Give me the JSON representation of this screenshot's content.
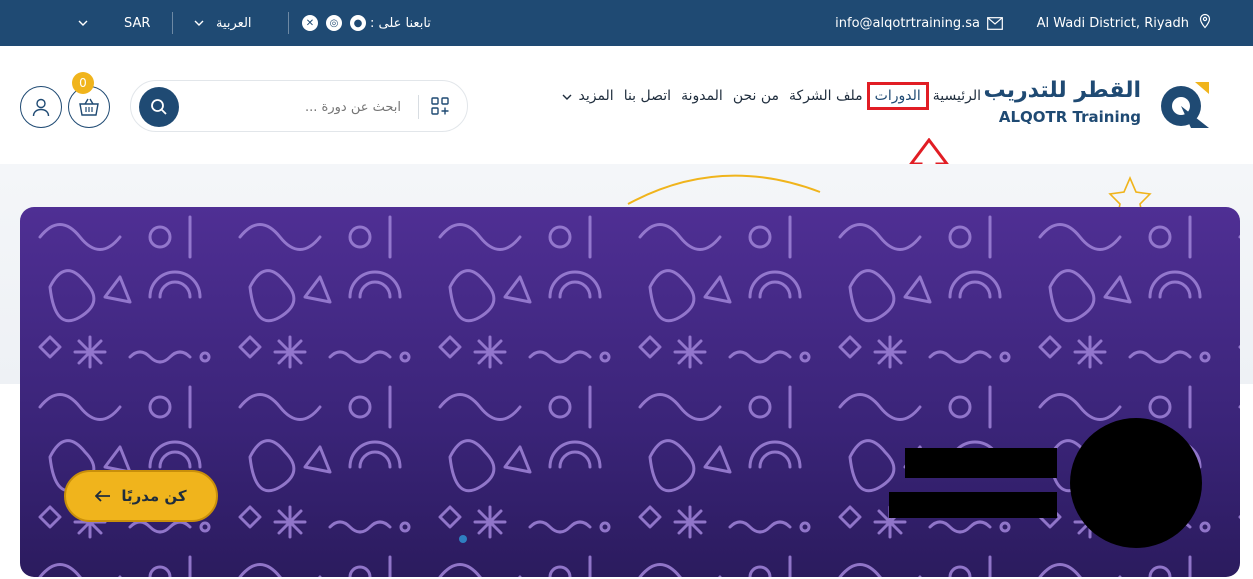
{
  "topbar": {
    "location": "Al Wadi District, Riyadh",
    "email": "info@alqotrtraining.sa",
    "follow_label": "تابعنا على :",
    "language": "العربية",
    "currency": "SAR"
  },
  "header": {
    "logo_ar": "القطر للتدريب",
    "logo_en": "ALQOTR Training",
    "nav": [
      "الرئيسية",
      "الدورات",
      "ملف الشركة",
      "من نحن",
      "المدونة",
      "اتصل بنا",
      "المزيد"
    ],
    "active_nav": "الدورات",
    "search_placeholder": "ابحث عن دورة ...",
    "cart_count": "0"
  },
  "hero": {
    "cta_label": "كن مدربًا"
  },
  "colors": {
    "brand": "#1f4a73",
    "accent": "#f0b41c",
    "banner": "#4f2f94",
    "highlight": "#e11d24"
  }
}
